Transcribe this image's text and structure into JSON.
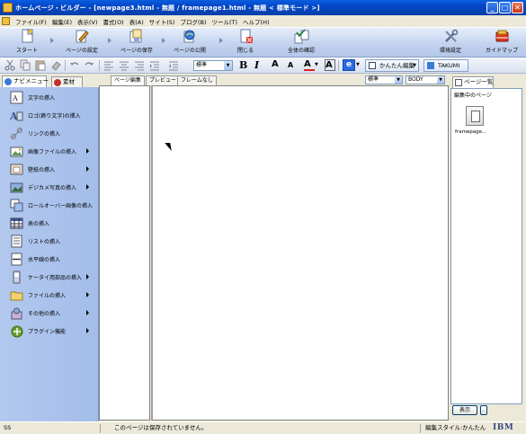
{
  "window": {
    "title": "ホームページ・ビルダー - [newpage3.html - 無題 / framepage1.html - 無題 < 標準モード >]",
    "buttons": [
      "_",
      "□",
      "✕"
    ]
  },
  "menubar": {
    "items": [
      "ファイル(F)",
      "編集(E)",
      "表示(V)",
      "書式(O)",
      "表(A)",
      "サイト(S)",
      "ブログ(B)",
      "ツール(T)",
      "ヘルプ(H)"
    ]
  },
  "bigtoolbar": {
    "start": "スタート",
    "page_settings": "ページの設定",
    "page_save": "ページの保存",
    "page_publish": "ページの公開",
    "close": "閉じる",
    "overall_check": "全体の確認",
    "env_settings": "環境設定",
    "guide_map": "ガイドマップ"
  },
  "formatbar": {
    "style_select": "標準",
    "bold": "B",
    "italic": "I",
    "font_up": "A",
    "font_down": "A",
    "font_color": "A",
    "highlight": "A",
    "e_icon": "e",
    "easy_edit": "かんたん編集",
    "takumi": "TAKUMI"
  },
  "lefttabs": {
    "nav_menu": "ナビメニュー",
    "material": "素材"
  },
  "navmenu": {
    "items": [
      {
        "label": "文字の挿入",
        "arrow": false
      },
      {
        "label": "ロゴ(飾り文字)の挿入",
        "arrow": false
      },
      {
        "label": "リンクの挿入",
        "arrow": false
      },
      {
        "label": "画像ファイルの挿入",
        "arrow": true
      },
      {
        "label": "壁紙の挿入",
        "arrow": true
      },
      {
        "label": "デジカメ写真の挿入",
        "arrow": true
      },
      {
        "label": "ロールオーバー画像の挿入",
        "arrow": false
      },
      {
        "label": "表の挿入",
        "arrow": false
      },
      {
        "label": "リストの挿入",
        "arrow": false
      },
      {
        "label": "水平線の挿入",
        "arrow": false
      },
      {
        "label": "ケータイ用部品の挿入",
        "arrow": true
      },
      {
        "label": "ファイルの挿入",
        "arrow": true
      },
      {
        "label": "その他の挿入",
        "arrow": true
      },
      {
        "label": "プラグイン機能",
        "arrow": true
      }
    ]
  },
  "editor": {
    "tabs": [
      "ページ編集",
      "プレビュー",
      "フレームなし"
    ],
    "style_select": "標準",
    "tag_select": "BODY"
  },
  "rightpanel": {
    "tab": "ページ一覧",
    "heading": "編集中のページ",
    "file_label": "framepage...",
    "show_button": "表示",
    "more_button": "."
  },
  "statusbar": {
    "left": "SS",
    "message": "このページは保存されていません。",
    "edit_style": "編集スタイル:かんたん",
    "brand": "IBM"
  }
}
